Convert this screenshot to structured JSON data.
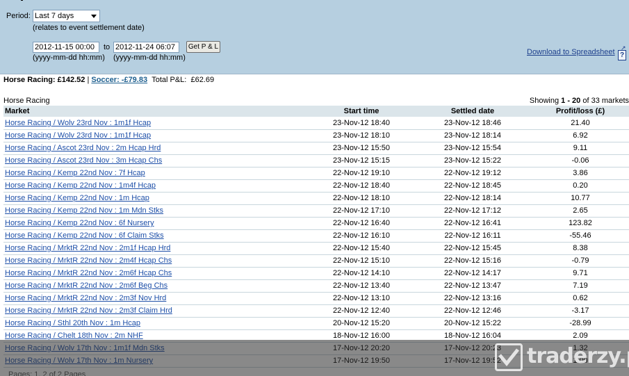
{
  "filter": {
    "period_label": "Period:",
    "period_value": "Last 7 days",
    "settle_note": "(relates to event settlement date)",
    "from_value": "2012-11-15 00:00",
    "to_label": "to",
    "to_value": "2012-11-24 06:07",
    "get_pl_label": "Get P & L",
    "from_hint": "(yyyy-mm-dd hh:mm)",
    "to_hint": "(yyyy-mm-dd hh:mm)",
    "download_label": "Download to Spreadsheet",
    "help_label": "?"
  },
  "totals": {
    "horse_racing": "Horse Racing: £142.52",
    "separator": "|",
    "soccer": "Soccer: -£79.83",
    "total_label": "Total P&L:",
    "total_value": "£62.69"
  },
  "section": {
    "title": "Horse Racing",
    "showing_prefix": "Showing",
    "showing_range": "1 - 20",
    "showing_suffix": "of 33 markets"
  },
  "table": {
    "headers": {
      "market": "Market",
      "start": "Start time",
      "settled": "Settled date",
      "pl": "Profit/loss (£)"
    },
    "rows": [
      {
        "market": "Horse Racing / Wolv 23rd Nov : 1m1f Hcap",
        "start": "23-Nov-12 18:40",
        "settled": "23-Nov-12 18:46",
        "pl": "21.40"
      },
      {
        "market": "Horse Racing / Wolv 23rd Nov : 1m1f Hcap",
        "start": "23-Nov-12 18:10",
        "settled": "23-Nov-12 18:14",
        "pl": "6.92"
      },
      {
        "market": "Horse Racing / Ascot 23rd Nov : 2m Hcap Hrd",
        "start": "23-Nov-12 15:50",
        "settled": "23-Nov-12 15:54",
        "pl": "9.11"
      },
      {
        "market": "Horse Racing / Ascot 23rd Nov : 3m Hcap Chs",
        "start": "23-Nov-12 15:15",
        "settled": "23-Nov-12 15:22",
        "pl": "-0.06"
      },
      {
        "market": "Horse Racing / Kemp 22nd Nov : 7f Hcap",
        "start": "22-Nov-12 19:10",
        "settled": "22-Nov-12 19:12",
        "pl": "3.86"
      },
      {
        "market": "Horse Racing / Kemp 22nd Nov : 1m4f Hcap",
        "start": "22-Nov-12 18:40",
        "settled": "22-Nov-12 18:45",
        "pl": "0.20"
      },
      {
        "market": "Horse Racing / Kemp 22nd Nov : 1m Hcap",
        "start": "22-Nov-12 18:10",
        "settled": "22-Nov-12 18:14",
        "pl": "10.77"
      },
      {
        "market": "Horse Racing / Kemp 22nd Nov : 1m Mdn Stks",
        "start": "22-Nov-12 17:10",
        "settled": "22-Nov-12 17:12",
        "pl": "2.65"
      },
      {
        "market": "Horse Racing / Kemp 22nd Nov : 6f Nursery",
        "start": "22-Nov-12 16:40",
        "settled": "22-Nov-12 16:41",
        "pl": "123.82"
      },
      {
        "market": "Horse Racing / Kemp 22nd Nov : 6f Claim Stks",
        "start": "22-Nov-12 16:10",
        "settled": "22-Nov-12 16:11",
        "pl": "-55.46"
      },
      {
        "market": "Horse Racing / MrktR 22nd Nov : 2m1f Hcap Hrd",
        "start": "22-Nov-12 15:40",
        "settled": "22-Nov-12 15:45",
        "pl": "8.38"
      },
      {
        "market": "Horse Racing / MrktR 22nd Nov : 2m4f Hcap Chs",
        "start": "22-Nov-12 15:10",
        "settled": "22-Nov-12 15:16",
        "pl": "-0.79"
      },
      {
        "market": "Horse Racing / MrktR 22nd Nov : 2m6f Hcap Chs",
        "start": "22-Nov-12 14:10",
        "settled": "22-Nov-12 14:17",
        "pl": "9.71"
      },
      {
        "market": "Horse Racing / MrktR 22nd Nov : 2m6f Beg Chs",
        "start": "22-Nov-12 13:40",
        "settled": "22-Nov-12 13:47",
        "pl": "7.19"
      },
      {
        "market": "Horse Racing / MrktR 22nd Nov : 2m3f Nov Hrd",
        "start": "22-Nov-12 13:10",
        "settled": "22-Nov-12 13:16",
        "pl": "0.62"
      },
      {
        "market": "Horse Racing / MrktR 22nd Nov : 2m3f Claim Hrd",
        "start": "22-Nov-12 12:40",
        "settled": "22-Nov-12 12:46",
        "pl": "-3.17"
      },
      {
        "market": "Horse Racing / Sthl 20th Nov : 1m Hcap",
        "start": "20-Nov-12 15:20",
        "settled": "20-Nov-12 15:22",
        "pl": "-28.99"
      },
      {
        "market": "Horse Racing / Chelt 18th Nov : 2m NHF",
        "start": "18-Nov-12 16:00",
        "settled": "18-Nov-12 16:04",
        "pl": "2.09"
      },
      {
        "market": "Horse Racing / Wolv 17th Nov : 1m1f Mdn Stks",
        "start": "17-Nov-12 20:20",
        "settled": "17-Nov-12 20:23",
        "pl": "1.32"
      },
      {
        "market": "Horse Racing / Wolv 17th Nov : 1m Nursery",
        "start": "17-Nov-12 19:50",
        "settled": "17-Nov-12 19:52",
        "pl": "1.00"
      }
    ]
  },
  "pagination": {
    "text": "Pages: 1, 2 of 2 Pages"
  },
  "watermark": {
    "text": "traderzy.pl"
  }
}
